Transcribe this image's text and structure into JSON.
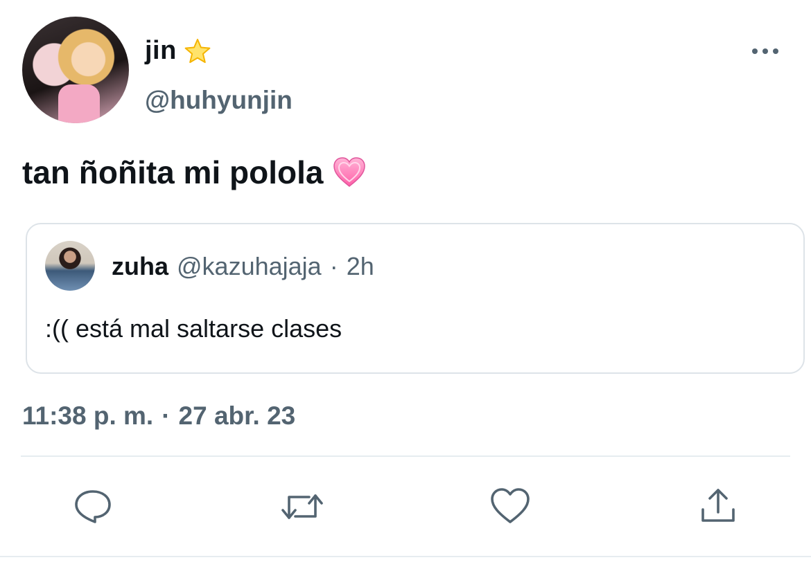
{
  "tweet": {
    "author": {
      "name": "jin",
      "badge_icon": "star-icon",
      "handle": "@huhyunjin"
    },
    "text": "tan ñoñita mi polola",
    "text_emoji_icon": "pink-heart-icon",
    "more_icon": "more-icon",
    "quoted": {
      "name": "zuha",
      "handle": "@kazuhajaja",
      "separator": "·",
      "time": "2h",
      "text": ":(( está mal saltarse clases"
    },
    "timestamp": {
      "time": "11:38 p. m.",
      "separator": "·",
      "date": "27 abr. 23"
    },
    "actions": [
      "reply-icon",
      "retweet-icon",
      "like-icon",
      "share-icon"
    ]
  },
  "colors": {
    "text": "#0f1419",
    "secondary": "#536471",
    "border": "#dde3e8",
    "heart": "#ff7ab8"
  }
}
